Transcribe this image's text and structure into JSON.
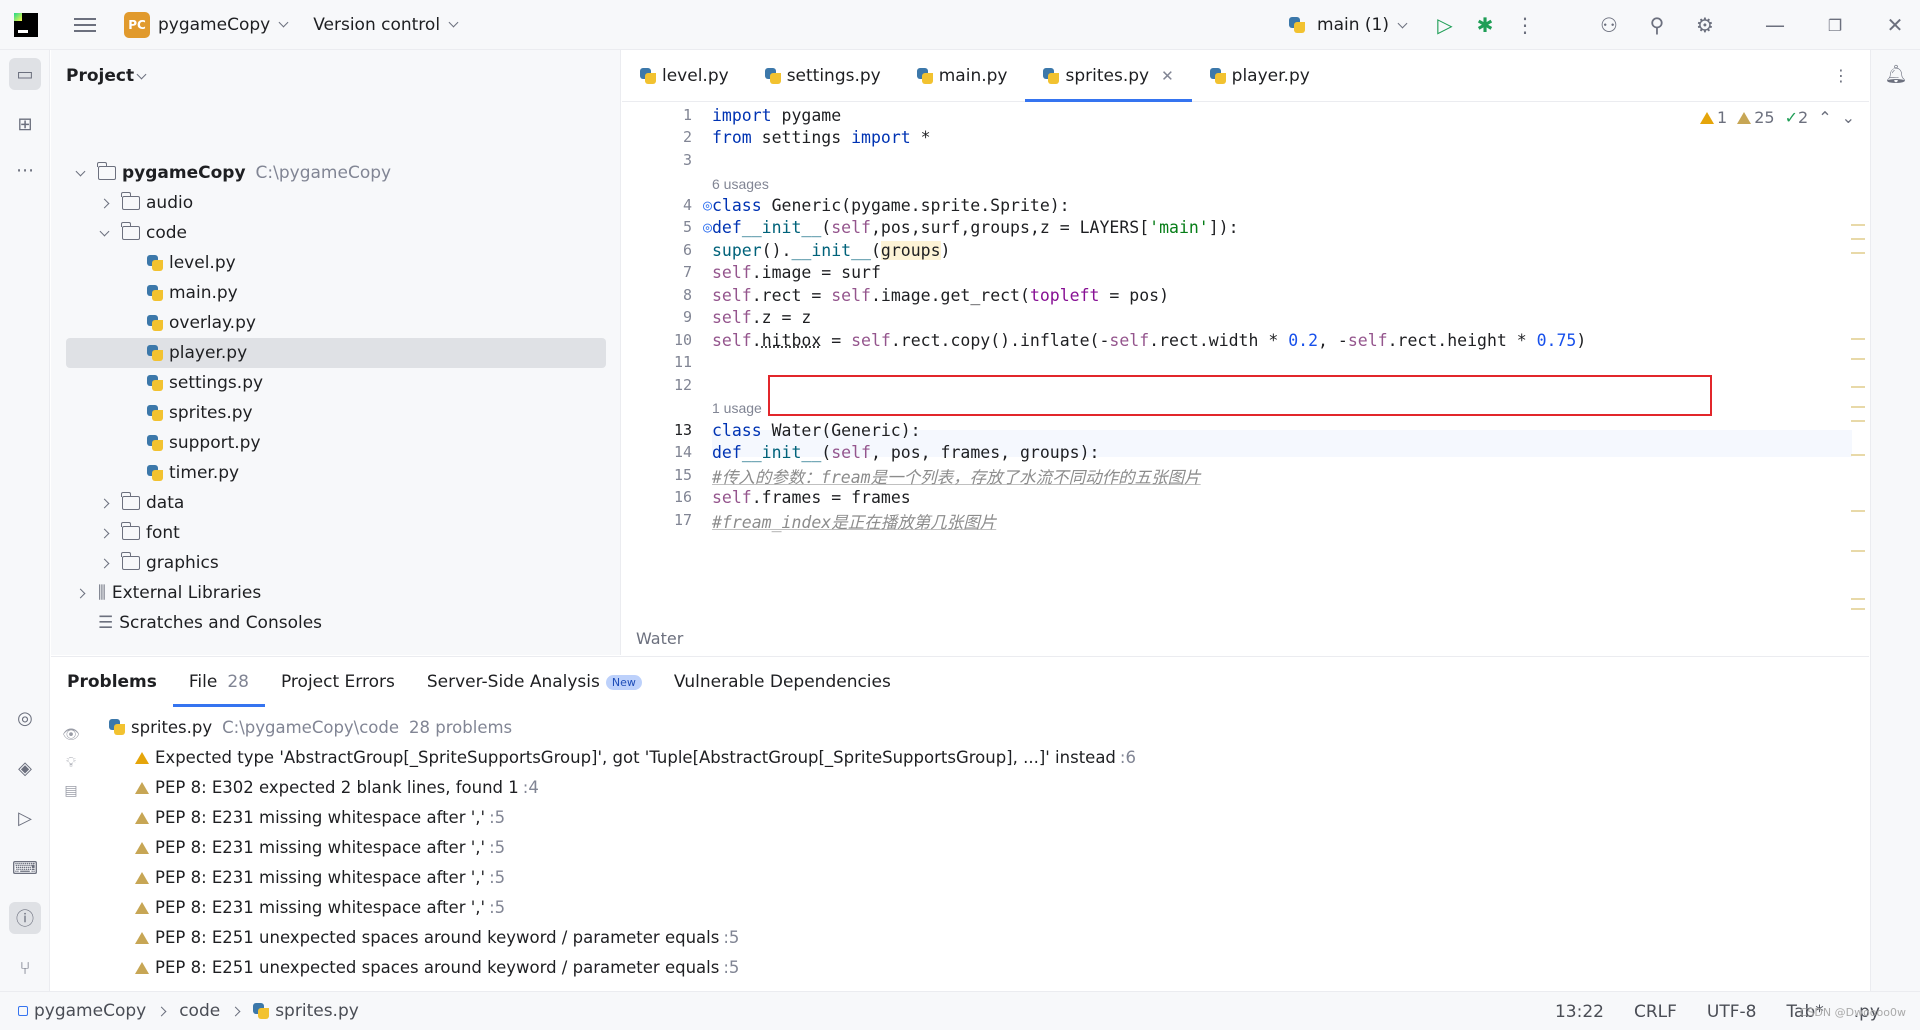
{
  "titlebar": {
    "project_badge": "PC",
    "project_name": "pygameCopy",
    "vcs": "Version control",
    "run_config": "main (1)"
  },
  "project_panel": {
    "title": "Project",
    "tree": [
      {
        "label": "pygameCopy",
        "path": "C:\\pygameCopy",
        "type": "folder",
        "expanded": true,
        "depth": 0
      },
      {
        "label": "audio",
        "type": "folder",
        "expanded": false,
        "depth": 1
      },
      {
        "label": "code",
        "type": "folder",
        "expanded": true,
        "depth": 1
      },
      {
        "label": "level.py",
        "type": "py",
        "depth": 2
      },
      {
        "label": "main.py",
        "type": "py",
        "depth": 2
      },
      {
        "label": "overlay.py",
        "type": "py",
        "depth": 2
      },
      {
        "label": "player.py",
        "type": "py",
        "depth": 2,
        "selected": true
      },
      {
        "label": "settings.py",
        "type": "py",
        "depth": 2
      },
      {
        "label": "sprites.py",
        "type": "py",
        "depth": 2
      },
      {
        "label": "support.py",
        "type": "py",
        "depth": 2
      },
      {
        "label": "timer.py",
        "type": "py",
        "depth": 2
      },
      {
        "label": "data",
        "type": "folder",
        "expanded": false,
        "depth": 1
      },
      {
        "label": "font",
        "type": "folder",
        "expanded": false,
        "depth": 1
      },
      {
        "label": "graphics",
        "type": "folder",
        "expanded": false,
        "depth": 1
      },
      {
        "label": "External Libraries",
        "type": "lib",
        "expanded": false,
        "depth": 0
      },
      {
        "label": "Scratches and Consoles",
        "type": "scratch",
        "depth": 0
      }
    ]
  },
  "editor": {
    "tabs": [
      {
        "label": "level.py",
        "active": false
      },
      {
        "label": "settings.py",
        "active": false
      },
      {
        "label": "main.py",
        "active": false
      },
      {
        "label": "sprites.py",
        "active": true
      },
      {
        "label": "player.py",
        "active": false
      }
    ],
    "inspections": {
      "warnings": "1",
      "weak_warnings": "25",
      "typos": "2"
    },
    "usage_hints": [
      "6 usages",
      "1 usage"
    ],
    "line_numbers": [
      "1",
      "2",
      "3",
      "4",
      "5",
      "6",
      "7",
      "8",
      "9",
      "10",
      "11",
      "12",
      "13",
      "14",
      "15",
      "16",
      "17"
    ],
    "code_breadcrumb": "Water"
  },
  "problems": {
    "tabs": [
      {
        "label": "Problems",
        "bold": true
      },
      {
        "label": "File",
        "count": "28",
        "active": true
      },
      {
        "label": "Project Errors"
      },
      {
        "label": "Server-Side Analysis",
        "badge": "New"
      },
      {
        "label": "Vulnerable Dependencies"
      }
    ],
    "file": {
      "name": "sprites.py",
      "path": "C:\\pygameCopy\\code",
      "summary": "28 problems"
    },
    "items": [
      {
        "text": "Expected type 'AbstractGroup[_SpriteSupportsGroup]', got 'Tuple[AbstractGroup[_SpriteSupportsGroup], ...]' instead",
        "line": ":6"
      },
      {
        "text": "PEP 8: E302 expected 2 blank lines, found 1",
        "line": ":4"
      },
      {
        "text": "PEP 8: E231 missing whitespace after ','",
        "line": ":5"
      },
      {
        "text": "PEP 8: E231 missing whitespace after ','",
        "line": ":5"
      },
      {
        "text": "PEP 8: E231 missing whitespace after ','",
        "line": ":5"
      },
      {
        "text": "PEP 8: E231 missing whitespace after ','",
        "line": ":5"
      },
      {
        "text": "PEP 8: E251 unexpected spaces around keyword / parameter equals",
        "line": ":5"
      },
      {
        "text": "PEP 8: E251 unexpected spaces around keyword / parameter equals",
        "line": ":5"
      }
    ]
  },
  "statusbar": {
    "crumbs": [
      "pygameCopy",
      "code",
      "sprites.py"
    ],
    "position": "13:22",
    "line_sep": "CRLF",
    "encoding": "UTF-8",
    "indent": "Tab*",
    "filetype": ".py",
    "watermark": "CSDN @Dwoooo0w"
  },
  "colors": {
    "accent": "#3574f0",
    "highlight_box": "#e2262b",
    "warning": "#e5a50a"
  }
}
